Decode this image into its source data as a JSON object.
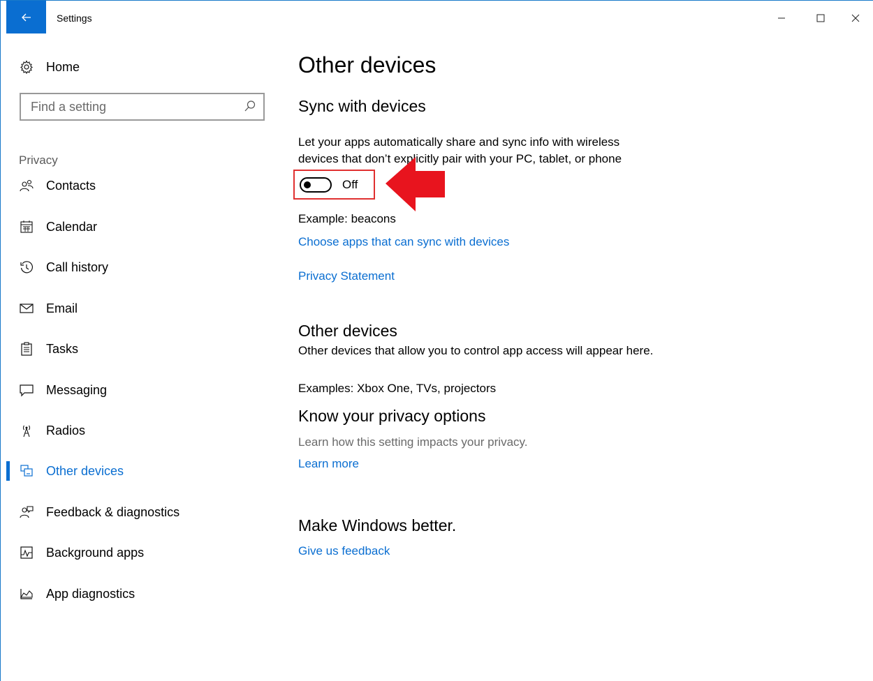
{
  "window": {
    "title": "Settings",
    "back_icon": "arrow-left-icon",
    "controls": {
      "minimize": "—",
      "maximize": "☐",
      "close": "✕"
    }
  },
  "sidebar": {
    "home_label": "Home",
    "search_placeholder": "Find a setting",
    "section_label": "Privacy",
    "items": [
      {
        "label": "Contacts",
        "icon": "contacts-icon",
        "active": false
      },
      {
        "label": "Calendar",
        "icon": "calendar-icon",
        "active": false
      },
      {
        "label": "Call history",
        "icon": "call-history-icon",
        "active": false
      },
      {
        "label": "Email",
        "icon": "email-icon",
        "active": false
      },
      {
        "label": "Tasks",
        "icon": "tasks-icon",
        "active": false
      },
      {
        "label": "Messaging",
        "icon": "messaging-icon",
        "active": false
      },
      {
        "label": "Radios",
        "icon": "radios-icon",
        "active": false
      },
      {
        "label": "Other devices",
        "icon": "other-devices-icon",
        "active": true
      },
      {
        "label": "Feedback & diagnostics",
        "icon": "feedback-icon",
        "active": false
      },
      {
        "label": "Background apps",
        "icon": "background-apps-icon",
        "active": false
      },
      {
        "label": "App diagnostics",
        "icon": "app-diagnostics-icon",
        "active": false
      }
    ]
  },
  "main": {
    "title": "Other devices",
    "sync_heading": "Sync with devices",
    "sync_description": "Let your apps automatically share and sync info with wireless devices that don’t explicitly pair with your PC, tablet, or phone",
    "toggle_state": "Off",
    "toggle_on": false,
    "example_beacons": "Example: beacons",
    "choose_apps_link": "Choose apps that can sync with devices",
    "privacy_statement_link": "Privacy Statement",
    "other_devices_heading": "Other devices",
    "other_devices_description": "Other devices that allow you to control app access will appear here.",
    "other_devices_examples": "Examples: Xbox One, TVs, projectors",
    "privacy_options_heading": "Know your privacy options",
    "privacy_options_description": "Learn how this setting impacts your privacy.",
    "learn_more_link": "Learn more",
    "make_better_heading": "Make Windows better.",
    "feedback_link": "Give us feedback"
  },
  "colors": {
    "accent": "#0a6ed1",
    "annotation_red": "#e8141e"
  }
}
